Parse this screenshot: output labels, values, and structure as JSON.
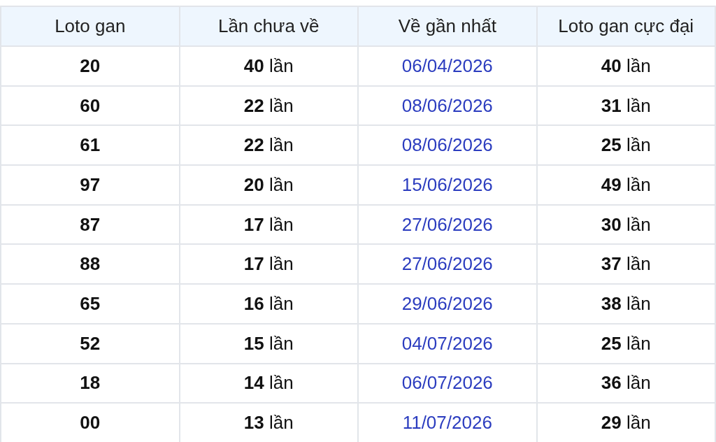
{
  "table": {
    "columns": [
      "Loto gan",
      "Lần chưa về",
      "Về gần nhất",
      "Loto gan cực đại"
    ],
    "rows": [
      {
        "loto": "20",
        "times_missing": "**40** lần",
        "last_seen": "06/04/2026",
        "max_gap": "**40** lần"
      },
      {
        "loto": "60",
        "times_missing": "**22** lần",
        "last_seen": "08/06/2026",
        "max_gap": "**31** lần"
      },
      {
        "loto": "61",
        "times_missing": "**22** lần",
        "last_seen": "08/06/2026",
        "max_gap": "**25** lần"
      },
      {
        "loto": "97",
        "times_missing": "**20** lần",
        "last_seen": "15/06/2026",
        "max_gap": "**49** lần"
      },
      {
        "loto": "87",
        "times_missing": "**17** lần",
        "last_seen": "27/06/2026",
        "max_gap": "**30** lần"
      },
      {
        "loto": "88",
        "times_missing": "**17** lần",
        "last_seen": "27/06/2026",
        "max_gap": "**37** lần"
      },
      {
        "loto": "65",
        "times_missing": "**16** lần",
        "last_seen": "29/06/2026",
        "max_gap": "**38** lần"
      },
      {
        "loto": "52",
        "times_missing": "**15** lần",
        "last_seen": "04/07/2026",
        "max_gap": "**25** lần"
      },
      {
        "loto": "18",
        "times_missing": "**14** lần",
        "last_seen": "06/07/2026",
        "max_gap": "**36** lần"
      },
      {
        "loto": "00",
        "times_missing": "**13** lần",
        "last_seen": "11/07/2026",
        "max_gap": "**29** lần"
      }
    ]
  }
}
